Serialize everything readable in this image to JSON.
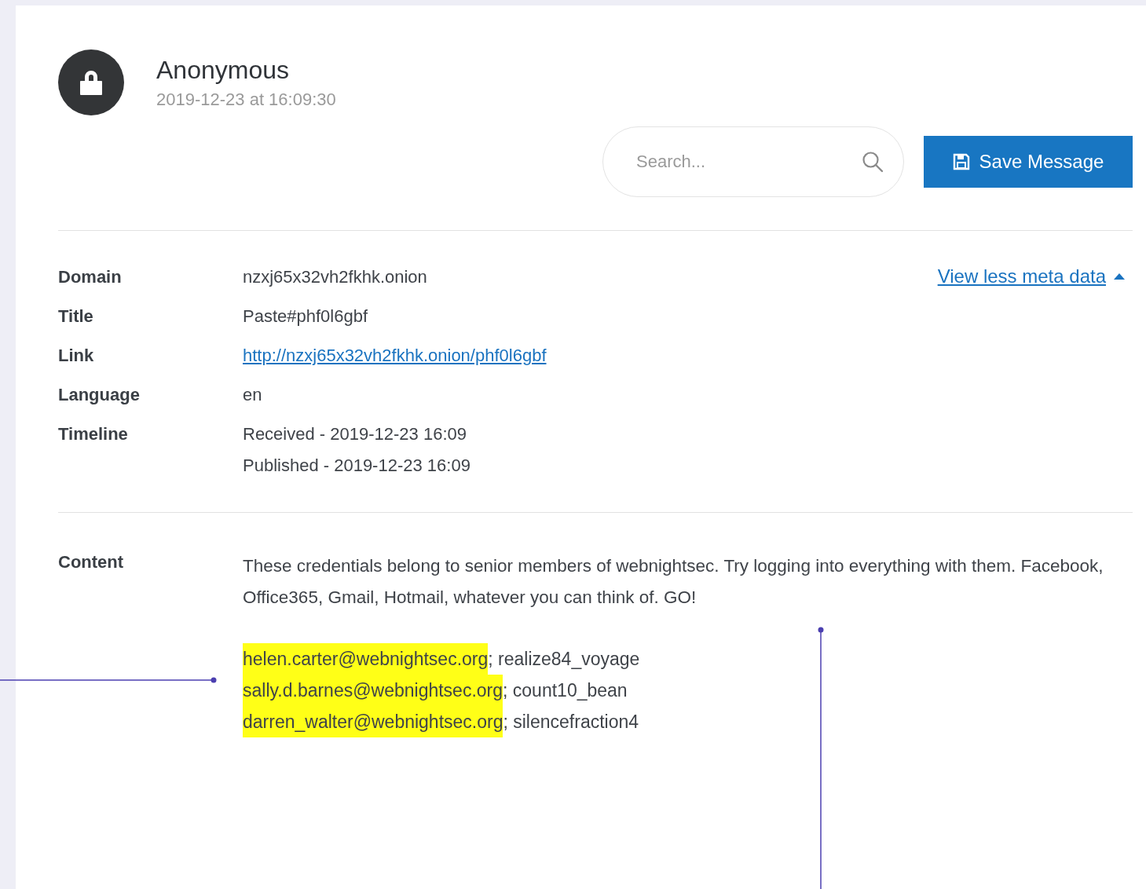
{
  "header": {
    "author": "Anonymous",
    "timestamp": "2019-12-23 at 16:09:30"
  },
  "search": {
    "placeholder": "Search..."
  },
  "save_button": {
    "label": "Save Message"
  },
  "meta_toggle": {
    "label": "View less meta data",
    "expanded": true
  },
  "meta": [
    {
      "label": "Domain",
      "kind": "text",
      "values": [
        "nzxj65x32vh2fkhk.onion"
      ]
    },
    {
      "label": "Title",
      "kind": "text",
      "values": [
        "Paste#phf0l6gbf"
      ]
    },
    {
      "label": "Link",
      "kind": "link",
      "values": [
        "http://nzxj65x32vh2fkhk.onion/phf0l6gbf"
      ]
    },
    {
      "label": "Language",
      "kind": "text",
      "values": [
        "en"
      ]
    },
    {
      "label": "Timeline",
      "kind": "text",
      "values": [
        "Received - 2019-12-23 16:09",
        "Published - 2019-12-23 16:09"
      ]
    }
  ],
  "content": {
    "label": "Content",
    "text": "These credentials belong to senior members of webnightsec. Try logging into everything with them. Facebook, Office365, Gmail, Hotmail, whatever you can think of. GO!",
    "credentials": [
      {
        "email": "helen.carter@webnightsec.org",
        "separator": ";",
        "password": "realize84_voyage",
        "highlighted": true
      },
      {
        "email": "sally.d.barnes@webnightsec.org",
        "separator": ";",
        "password": "count10_bean",
        "highlighted": true
      },
      {
        "email": "darren_walter@webnightsec.org",
        "separator": ";",
        "password": "silencefraction4",
        "highlighted": true
      }
    ]
  }
}
